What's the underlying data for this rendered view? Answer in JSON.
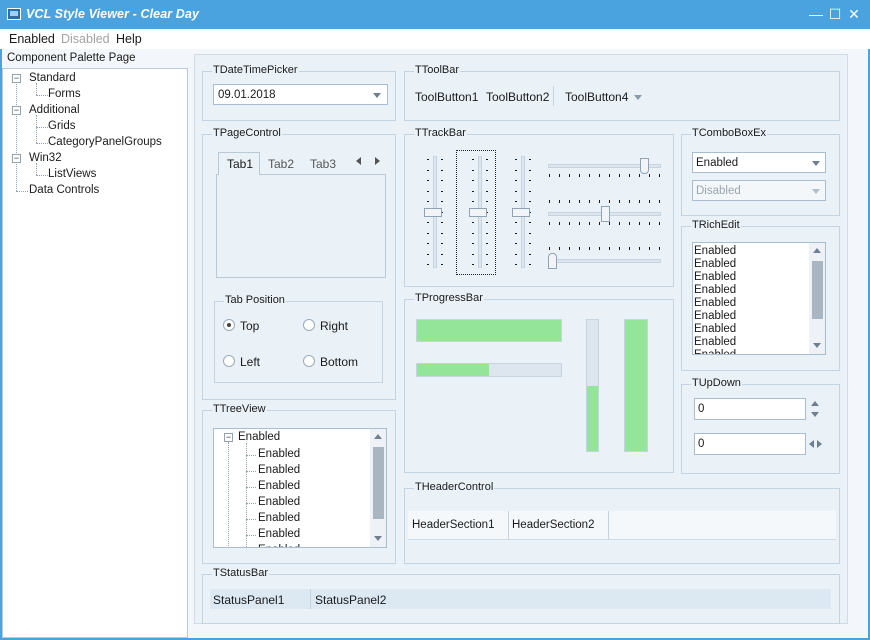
{
  "window": {
    "title": "VCL Style Viewer - Clear Day",
    "minimize": "—",
    "maximize": "☐",
    "close": "✕"
  },
  "menu": [
    {
      "label": "Enabled"
    },
    {
      "label": "Disabled"
    },
    {
      "label": "Help"
    }
  ],
  "palette_label": "Component Palette Page",
  "tree": [
    {
      "label": "Standard",
      "box": "−"
    },
    {
      "label": "Forms"
    },
    {
      "label": "Additional",
      "box": "−"
    },
    {
      "label": "Grids"
    },
    {
      "label": "CategoryPanelGroups"
    },
    {
      "label": "Win32",
      "box": "−"
    },
    {
      "label": "ListViews"
    },
    {
      "label": "Data Controls"
    }
  ],
  "groups": {
    "datetimepicker": "TDateTimePicker",
    "toolbar": "TToolBar",
    "pagecontrol": "TPageControl",
    "trackbar": "TTrackBar",
    "comboboxex": "TComboBoxEx",
    "richedit": "TRichEdit",
    "progressbar": "TProgressBar",
    "updown": "TUpDown",
    "treeview": "TTreeView",
    "headercontrol": "THeaderControl",
    "statusbar": "TStatusBar"
  },
  "datetimepicker": {
    "value": "09.01.2018"
  },
  "toolbar": {
    "buttons": [
      "ToolButton1",
      "ToolButton2",
      "ToolButton4"
    ]
  },
  "pagecontrol": {
    "tabs": [
      "Tab1",
      "Tab2",
      "Tab3"
    ],
    "active": 0
  },
  "tabposition": {
    "label": "Tab Position",
    "options": [
      "Top",
      "Right",
      "Left",
      "Bottom"
    ],
    "selected": "Top"
  },
  "trackbar": {
    "levels": [
      0.5,
      0.5,
      0.5,
      0.85,
      0.5,
      0.0
    ]
  },
  "comboboxex": {
    "enabled": "Enabled",
    "disabled": "Disabled"
  },
  "richedit": {
    "lines": [
      "Enabled",
      "Enabled",
      "Enabled",
      "Enabled",
      "Enabled",
      "Enabled",
      "Enabled",
      "Enabled",
      "Enabled"
    ]
  },
  "progressbar": {
    "h1": 1.0,
    "h2": 0.5,
    "v1": 0.5,
    "v2": 1.0
  },
  "updown": {
    "value1": "0",
    "value2": "0"
  },
  "treeview": {
    "root": "Enabled",
    "root_box": "−",
    "children": [
      "Enabled",
      "Enabled",
      "Enabled",
      "Enabled",
      "Enabled",
      "Enabled",
      "Enabled"
    ]
  },
  "headercontrol": {
    "sections": [
      "HeaderSection1",
      "HeaderSection2"
    ]
  },
  "statusbar": {
    "panels": [
      "StatusPanel1",
      "StatusPanel2"
    ]
  },
  "colors": {
    "accent": "#4aa3df",
    "progress": "#94e49a",
    "panel": "#eaf2f8"
  }
}
